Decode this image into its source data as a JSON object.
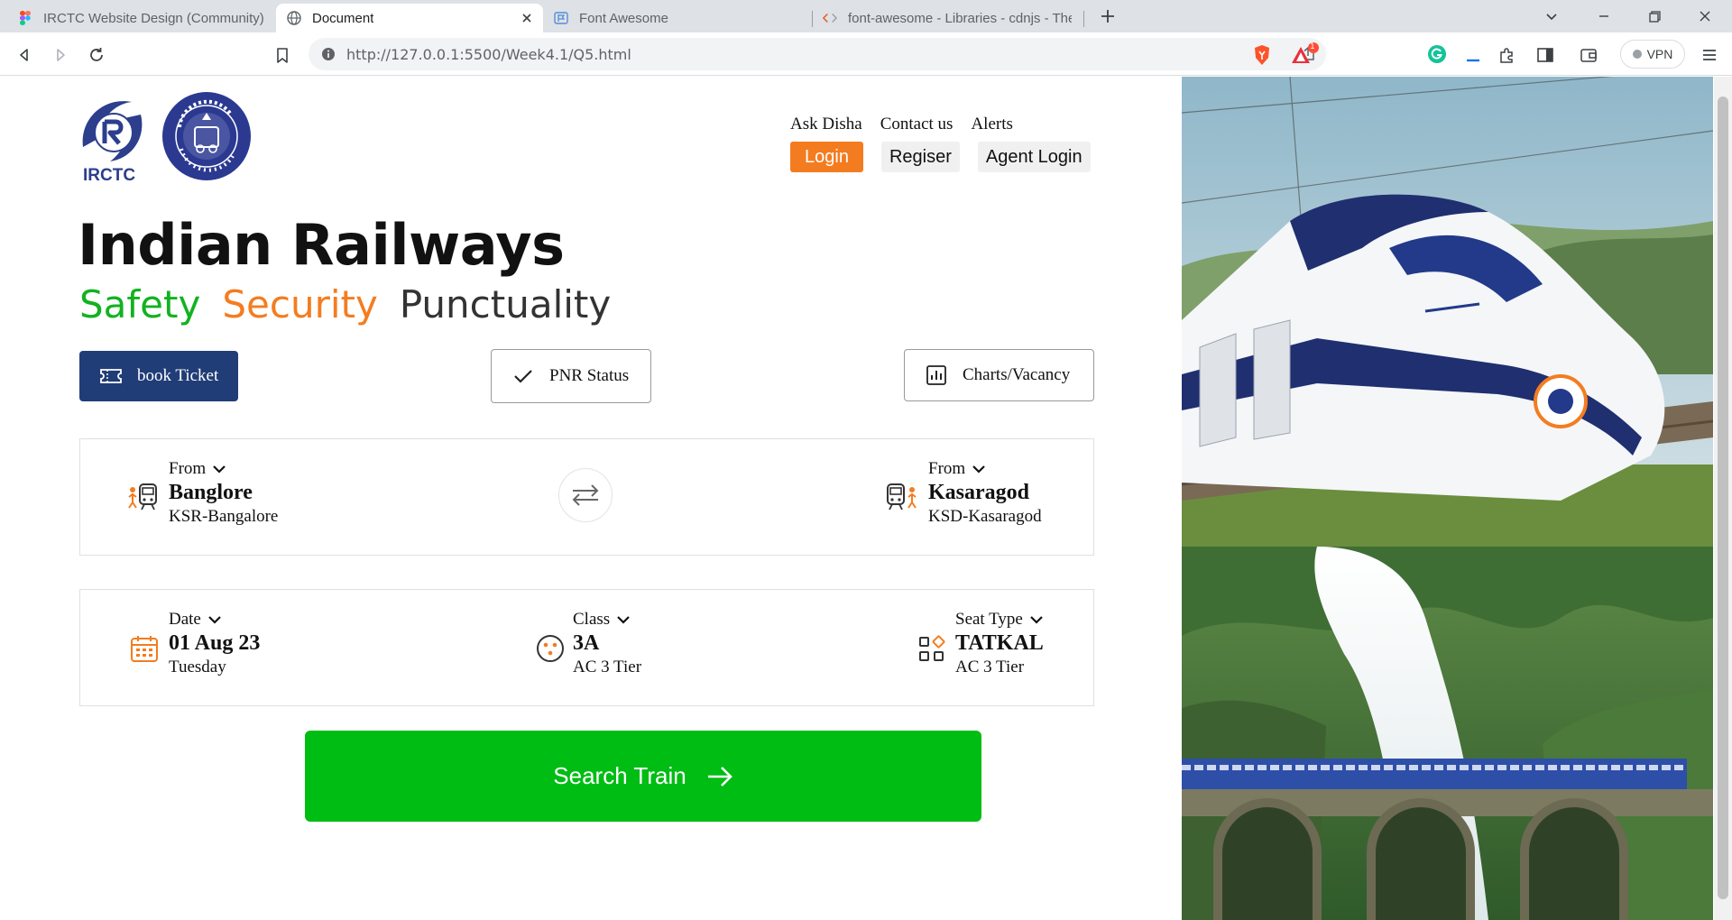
{
  "browser": {
    "tabs": [
      {
        "title": "IRCTC Website Design (Community) (C",
        "icon": "figma-icon"
      },
      {
        "title": "Document",
        "icon": "globe-icon"
      },
      {
        "title": "Font Awesome",
        "icon": "font-awesome-flag-icon"
      },
      {
        "title": "font-awesome - Libraries - cdnjs - The",
        "icon": "code-brackets-icon"
      }
    ],
    "url": "http://127.0.0.1:5500/Week4.1/Q5.html",
    "vpn_label": "VPN",
    "notification_count": "1"
  },
  "header": {
    "logo_text": "IRCTC",
    "links": [
      "Ask Disha",
      "Contact us",
      "Alerts"
    ],
    "buttons": [
      "Login",
      "Regiser",
      "Agent Login"
    ]
  },
  "hero": {
    "title": "Indian Railways",
    "tagline": [
      "Safety",
      "Security",
      "Punctuality"
    ]
  },
  "actions": {
    "book": "book Ticket",
    "pnr": "PNR Status",
    "charts": "Charts/Vacancy"
  },
  "journey": {
    "from": {
      "label": "From",
      "station": "Banglore",
      "code": "KSR-Bangalore"
    },
    "to": {
      "label": "From",
      "station": "Kasaragod",
      "code": "KSD-Kasaragod"
    }
  },
  "options": {
    "date": {
      "label": "Date",
      "value": "01 Aug 23",
      "sub": "Tuesday"
    },
    "class": {
      "label": "Class",
      "value": "3A",
      "sub": "AC 3 Tier"
    },
    "seat": {
      "label": "Seat Type",
      "value": "TATKAL",
      "sub": "AC 3 Tier"
    }
  },
  "search": {
    "label": "Search Train"
  },
  "colors": {
    "brand_navy": "#213d77",
    "accent_orange": "#f47c20",
    "accent_green": "#12b21f",
    "search_green": "#00bd14"
  }
}
